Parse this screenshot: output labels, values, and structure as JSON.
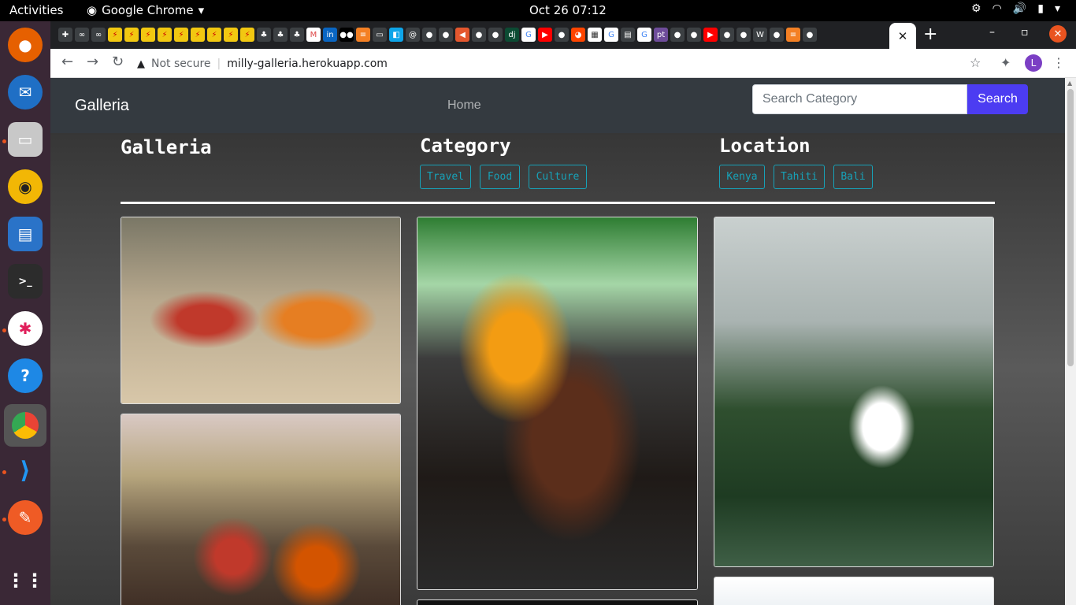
{
  "os": {
    "activities": "Activities",
    "app_name": "Google Chrome",
    "clock": "Oct 26  07:12"
  },
  "browser": {
    "security": "Not secure",
    "url": "milly-galleria.herokuapp.com",
    "profile_initial": "L"
  },
  "site": {
    "brand": "Galleria",
    "nav_home": "Home",
    "search": {
      "placeholder": "Search Category",
      "button": "Search"
    },
    "galleria_heading": "Galleria",
    "category_heading": "Category",
    "categories": [
      "Travel",
      "Food",
      "Culture"
    ],
    "location_heading": "Location",
    "locations": [
      "Kenya",
      "Tahiti",
      "Bali"
    ]
  },
  "colors": {
    "navbar": "#343a40",
    "search_button": "#4c3cf2",
    "tag_outline": "#17a2b8"
  }
}
